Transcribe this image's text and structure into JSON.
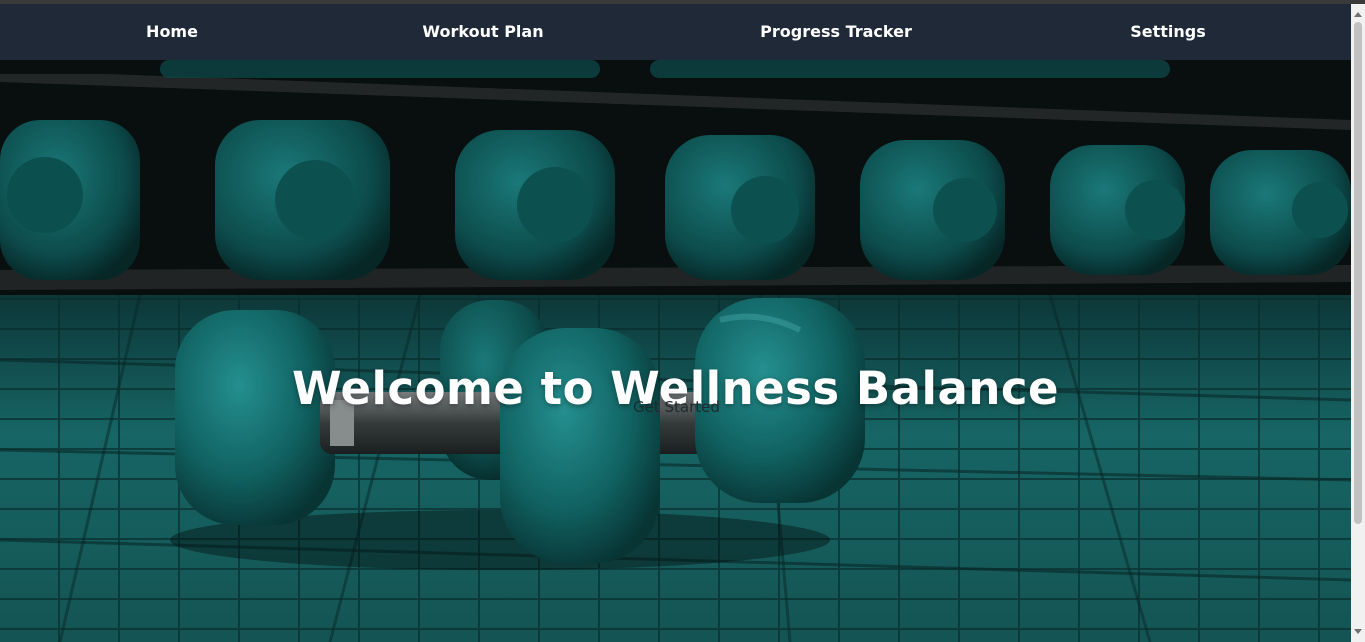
{
  "nav": {
    "items": [
      {
        "label": "Home"
      },
      {
        "label": "Workout Plan"
      },
      {
        "label": "Progress Tracker"
      },
      {
        "label": "Settings"
      }
    ]
  },
  "hero": {
    "title": "Welcome to Wellness Balance",
    "cta_label": "Get Started",
    "background": "teal dumbbells on gym floor"
  },
  "colors": {
    "navbar": "#1f2937",
    "nav_text": "#ffffff",
    "accent_teal": "#1a7a7a"
  }
}
